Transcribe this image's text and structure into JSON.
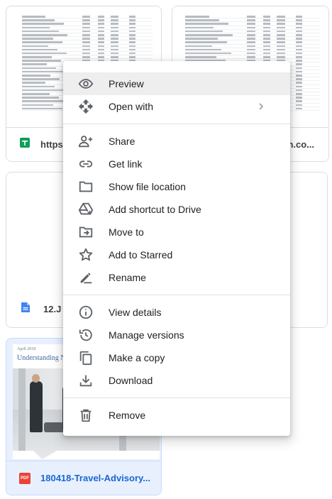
{
  "cards": [
    {
      "file_name": "https",
      "file_type": "sheets-icon"
    },
    {
      "file_name": "n.co...",
      "file_type": "sheets-icon"
    },
    {
      "file_name": "12.J",
      "file_type": "docs-icon"
    },
    {
      "file_name": "180418-Travel-Advisory...",
      "file_type": "pdf-icon",
      "pdf_badge": "PDF",
      "thumb_date": "April 2018",
      "thumb_title": "Understanding News"
    }
  ],
  "menu": {
    "items": [
      {
        "label": "Preview",
        "icon": "eye-icon"
      },
      {
        "label": "Open with",
        "icon": "open-with-icon"
      },
      {
        "label": "Share",
        "icon": "person-add-icon"
      },
      {
        "label": "Get link",
        "icon": "link-icon"
      },
      {
        "label": "Show file location",
        "icon": "folder-icon"
      },
      {
        "label": "Add shortcut to Drive",
        "icon": "add-shortcut-drive-icon"
      },
      {
        "label": "Move to",
        "icon": "move-to-folder-icon"
      },
      {
        "label": "Add to Starred",
        "icon": "star-icon"
      },
      {
        "label": "Rename",
        "icon": "pencil-icon"
      },
      {
        "label": "View details",
        "icon": "info-icon"
      },
      {
        "label": "Manage versions",
        "icon": "history-icon"
      },
      {
        "label": "Make a copy",
        "icon": "copy-icon"
      },
      {
        "label": "Download",
        "icon": "download-icon"
      },
      {
        "label": "Remove",
        "icon": "trash-icon"
      }
    ],
    "highlighted": "Preview"
  },
  "colors": {
    "sheets_green": "#0f9d58",
    "docs_blue": "#4285f4",
    "pdf_red": "#ea4335",
    "icon_gray": "#5f6368"
  }
}
